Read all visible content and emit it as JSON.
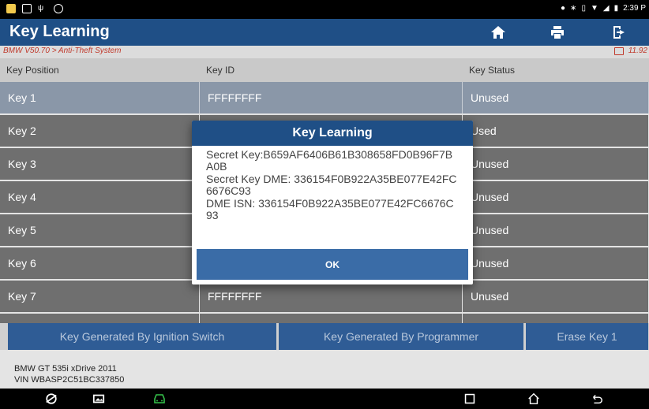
{
  "status_bar": {
    "time": "2:39 P"
  },
  "app": {
    "title": "Key Learning"
  },
  "breadcrumb": {
    "path": "BMW V50.70 > Anti-Theft System",
    "version": "11.92"
  },
  "table": {
    "headers": [
      "Key Position",
      "Key ID",
      "Key Status"
    ],
    "rows": [
      {
        "position": "Key 1",
        "id": "FFFFFFFF",
        "status": "Unused"
      },
      {
        "position": "Key 2",
        "id": "",
        "status": "Used"
      },
      {
        "position": "Key 3",
        "id": "",
        "status": "Unused"
      },
      {
        "position": "Key 4",
        "id": "",
        "status": "Unused"
      },
      {
        "position": "Key 5",
        "id": "",
        "status": "Unused"
      },
      {
        "position": "Key 6",
        "id": "",
        "status": "Unused"
      },
      {
        "position": "Key 7",
        "id": "FFFFFFFF",
        "status": "Unused"
      }
    ]
  },
  "dialog": {
    "title": "Key Learning",
    "lines": [
      "Secret Key:B659AF6406B61B308658FD0B96F7BA0B",
      "Secret Key DME: 336154F0B922A35BE077E42FC6676C93",
      "DME ISN: 336154F0B922A35BE077E42FC6676C93"
    ],
    "ok_label": "OK"
  },
  "actions": {
    "ignition": "Key Generated By Ignition Switch",
    "programmer": "Key Generated By Programmer",
    "erase": "Erase Key 1"
  },
  "vehicle": {
    "model": "BMW GT 535i xDrive 2011",
    "vin": "VIN WBASP2C51BC337850"
  }
}
